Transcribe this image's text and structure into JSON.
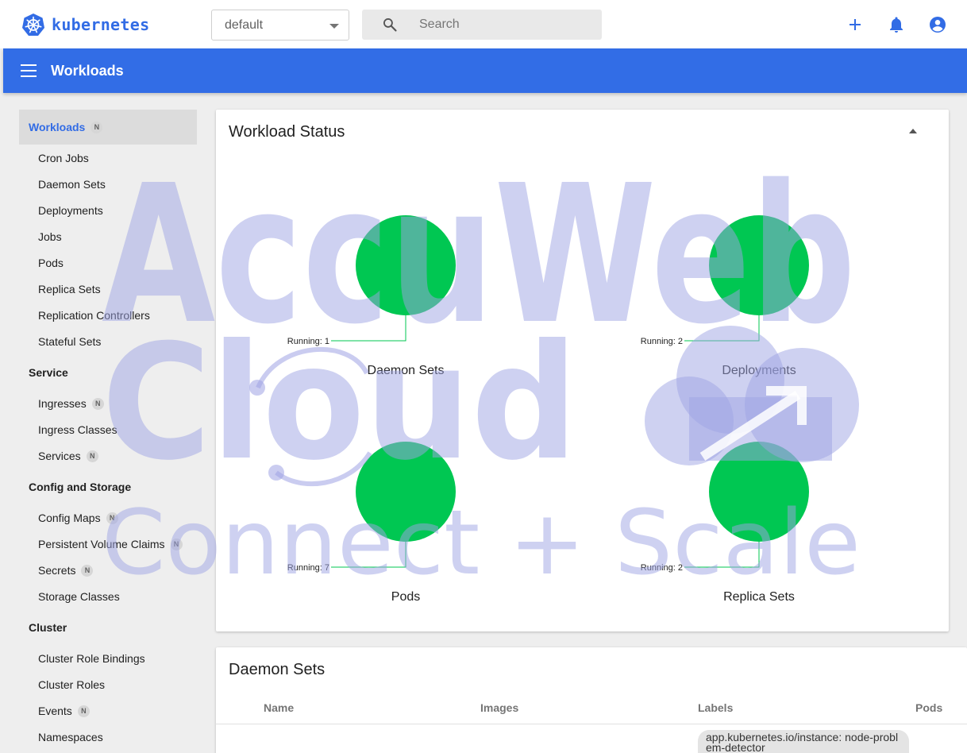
{
  "app": {
    "brand": "kubernetes",
    "brand_color": "#326ce5",
    "namespace": "default",
    "search_placeholder": "Search",
    "page_title": "Workloads",
    "header_color": "#326de6"
  },
  "toolbar": {
    "icons": [
      "plus-icon",
      "bell-icon",
      "account-icon"
    ]
  },
  "sidebar": {
    "sections": [
      {
        "title": "Workloads",
        "badge": "N",
        "active": true,
        "items": [
          {
            "label": "Cron Jobs"
          },
          {
            "label": "Daemon Sets"
          },
          {
            "label": "Deployments"
          },
          {
            "label": "Jobs"
          },
          {
            "label": "Pods"
          },
          {
            "label": "Replica Sets"
          },
          {
            "label": "Replication Controllers"
          },
          {
            "label": "Stateful Sets"
          }
        ]
      },
      {
        "title": "Service",
        "items": [
          {
            "label": "Ingresses",
            "badge": "N"
          },
          {
            "label": "Ingress Classes"
          },
          {
            "label": "Services",
            "badge": "N"
          }
        ]
      },
      {
        "title": "Config and Storage",
        "items": [
          {
            "label": "Config Maps",
            "badge": "N"
          },
          {
            "label": "Persistent Volume Claims",
            "badge": "N"
          },
          {
            "label": "Secrets",
            "badge": "N"
          },
          {
            "label": "Storage Classes"
          }
        ]
      },
      {
        "title": "Cluster",
        "items": [
          {
            "label": "Cluster Role Bindings"
          },
          {
            "label": "Cluster Roles"
          },
          {
            "label": "Events",
            "badge": "N"
          },
          {
            "label": "Namespaces"
          }
        ]
      }
    ]
  },
  "workload_status": {
    "title": "Workload Status",
    "running_color": "#00c752",
    "charts": [
      {
        "name": "Daemon Sets",
        "running_label": "Running: 1",
        "running": 1
      },
      {
        "name": "Deployments",
        "running_label": "Running: 2",
        "running": 2
      },
      {
        "name": "Pods",
        "running_label": "Running: 7",
        "running": 7
      },
      {
        "name": "Replica Sets",
        "running_label": "Running: 2",
        "running": 2
      }
    ]
  },
  "daemon_sets": {
    "title": "Daemon Sets",
    "columns": [
      "Name",
      "Images",
      "Labels",
      "Pods"
    ],
    "rows": [
      {
        "labels": "app.kubernetes.io/instance: node-problem-detector"
      }
    ]
  },
  "watermark": {
    "line1": "AccuWeb",
    "line2": "Cloud",
    "line3": "Connect + Scale",
    "color": "#9ea3e3"
  }
}
